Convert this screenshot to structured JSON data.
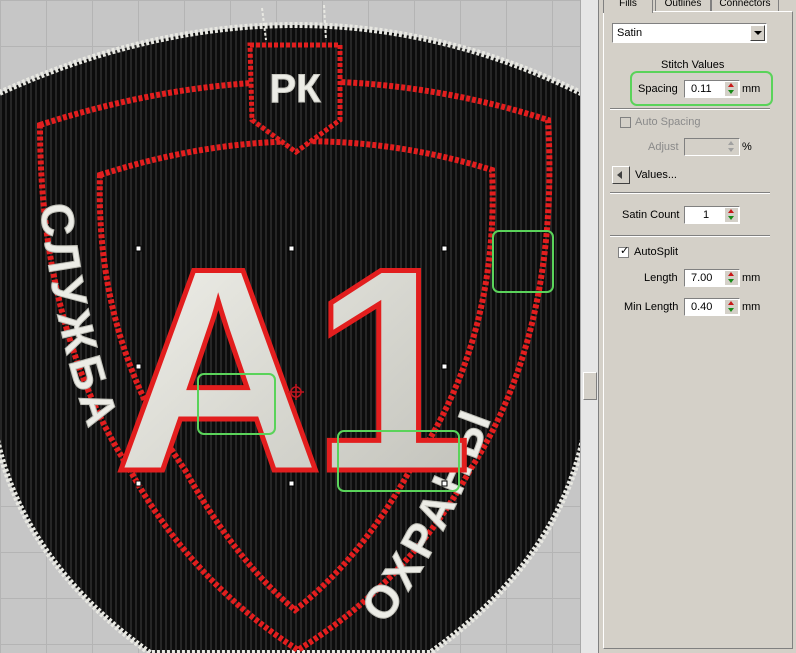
{
  "tabs": [
    "Fills",
    "Outlines",
    "Connectors"
  ],
  "active_tab": "Fills",
  "fill_type": "Satin",
  "stitch_values_heading": "Stitch Values",
  "spacing": {
    "label": "Spacing",
    "value": "0.11",
    "unit": "mm"
  },
  "auto_spacing": {
    "label": "Auto Spacing",
    "checked": false,
    "enabled": false
  },
  "adjust": {
    "label": "Adjust",
    "value": "",
    "unit": "%"
  },
  "values_button": "Values...",
  "satin_count": {
    "label": "Satin Count",
    "value": "1"
  },
  "auto_split": {
    "label": "AutoSplit",
    "checked": true
  },
  "length": {
    "label": "Length",
    "value": "7.00",
    "unit": "mm"
  },
  "min_length": {
    "label": "Min Length",
    "value": "0.40",
    "unit": "mm"
  },
  "design": {
    "top_text": "РК",
    "center_text": "А1",
    "left_arc_text": "СЛУЖБА",
    "right_arc_text": "ОХРАНЫ",
    "colors": {
      "base": "#101010",
      "border": "#e21e1e",
      "thread": "#ecece6",
      "highlight": "#5ad35a"
    }
  },
  "icons": [
    "dropdown-arrow-icon",
    "spin-up-icon",
    "spin-down-icon",
    "checkbox-check-icon",
    "left-arrow-icon",
    "crosshair-icon"
  ]
}
